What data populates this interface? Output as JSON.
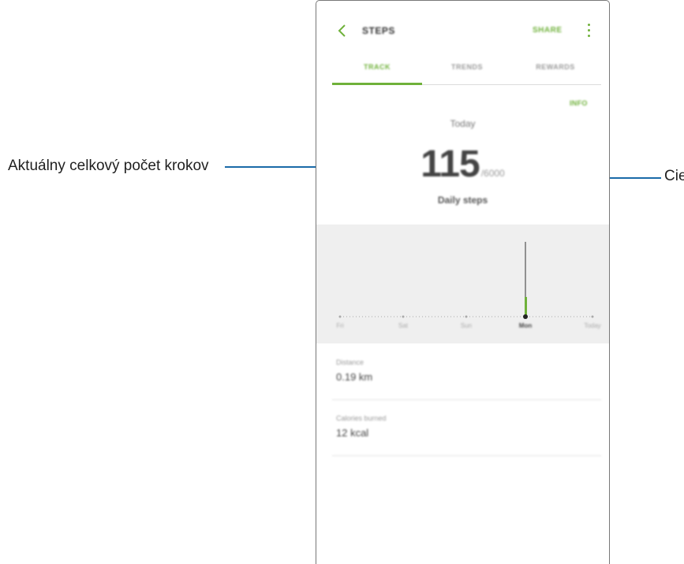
{
  "callouts": {
    "left": "Aktuálny celkový počet krokov",
    "right": "Cieľ"
  },
  "app": {
    "title": "STEPS",
    "share_label": "SHARE"
  },
  "tabs": [
    {
      "label": "TRACK",
      "active": true
    },
    {
      "label": "TRENDS",
      "active": false
    },
    {
      "label": "REWARDS",
      "active": false
    }
  ],
  "main": {
    "info_chip": "INFO",
    "date": "Today",
    "steps": "115",
    "target": "/6000",
    "steps_label": "Daily steps"
  },
  "chart": {
    "day_labels": [
      "Fri",
      "Sat",
      "Sun",
      "Mon",
      "Today"
    ],
    "selected_index": 3
  },
  "stats": [
    {
      "label": "Distance",
      "value": "0.19 km"
    },
    {
      "label": "Calories burned",
      "value": "12 kcal"
    }
  ],
  "colors": {
    "accent": "#6fb13a",
    "callout_line": "#1a6aa8",
    "chart_bg": "#efefef"
  }
}
